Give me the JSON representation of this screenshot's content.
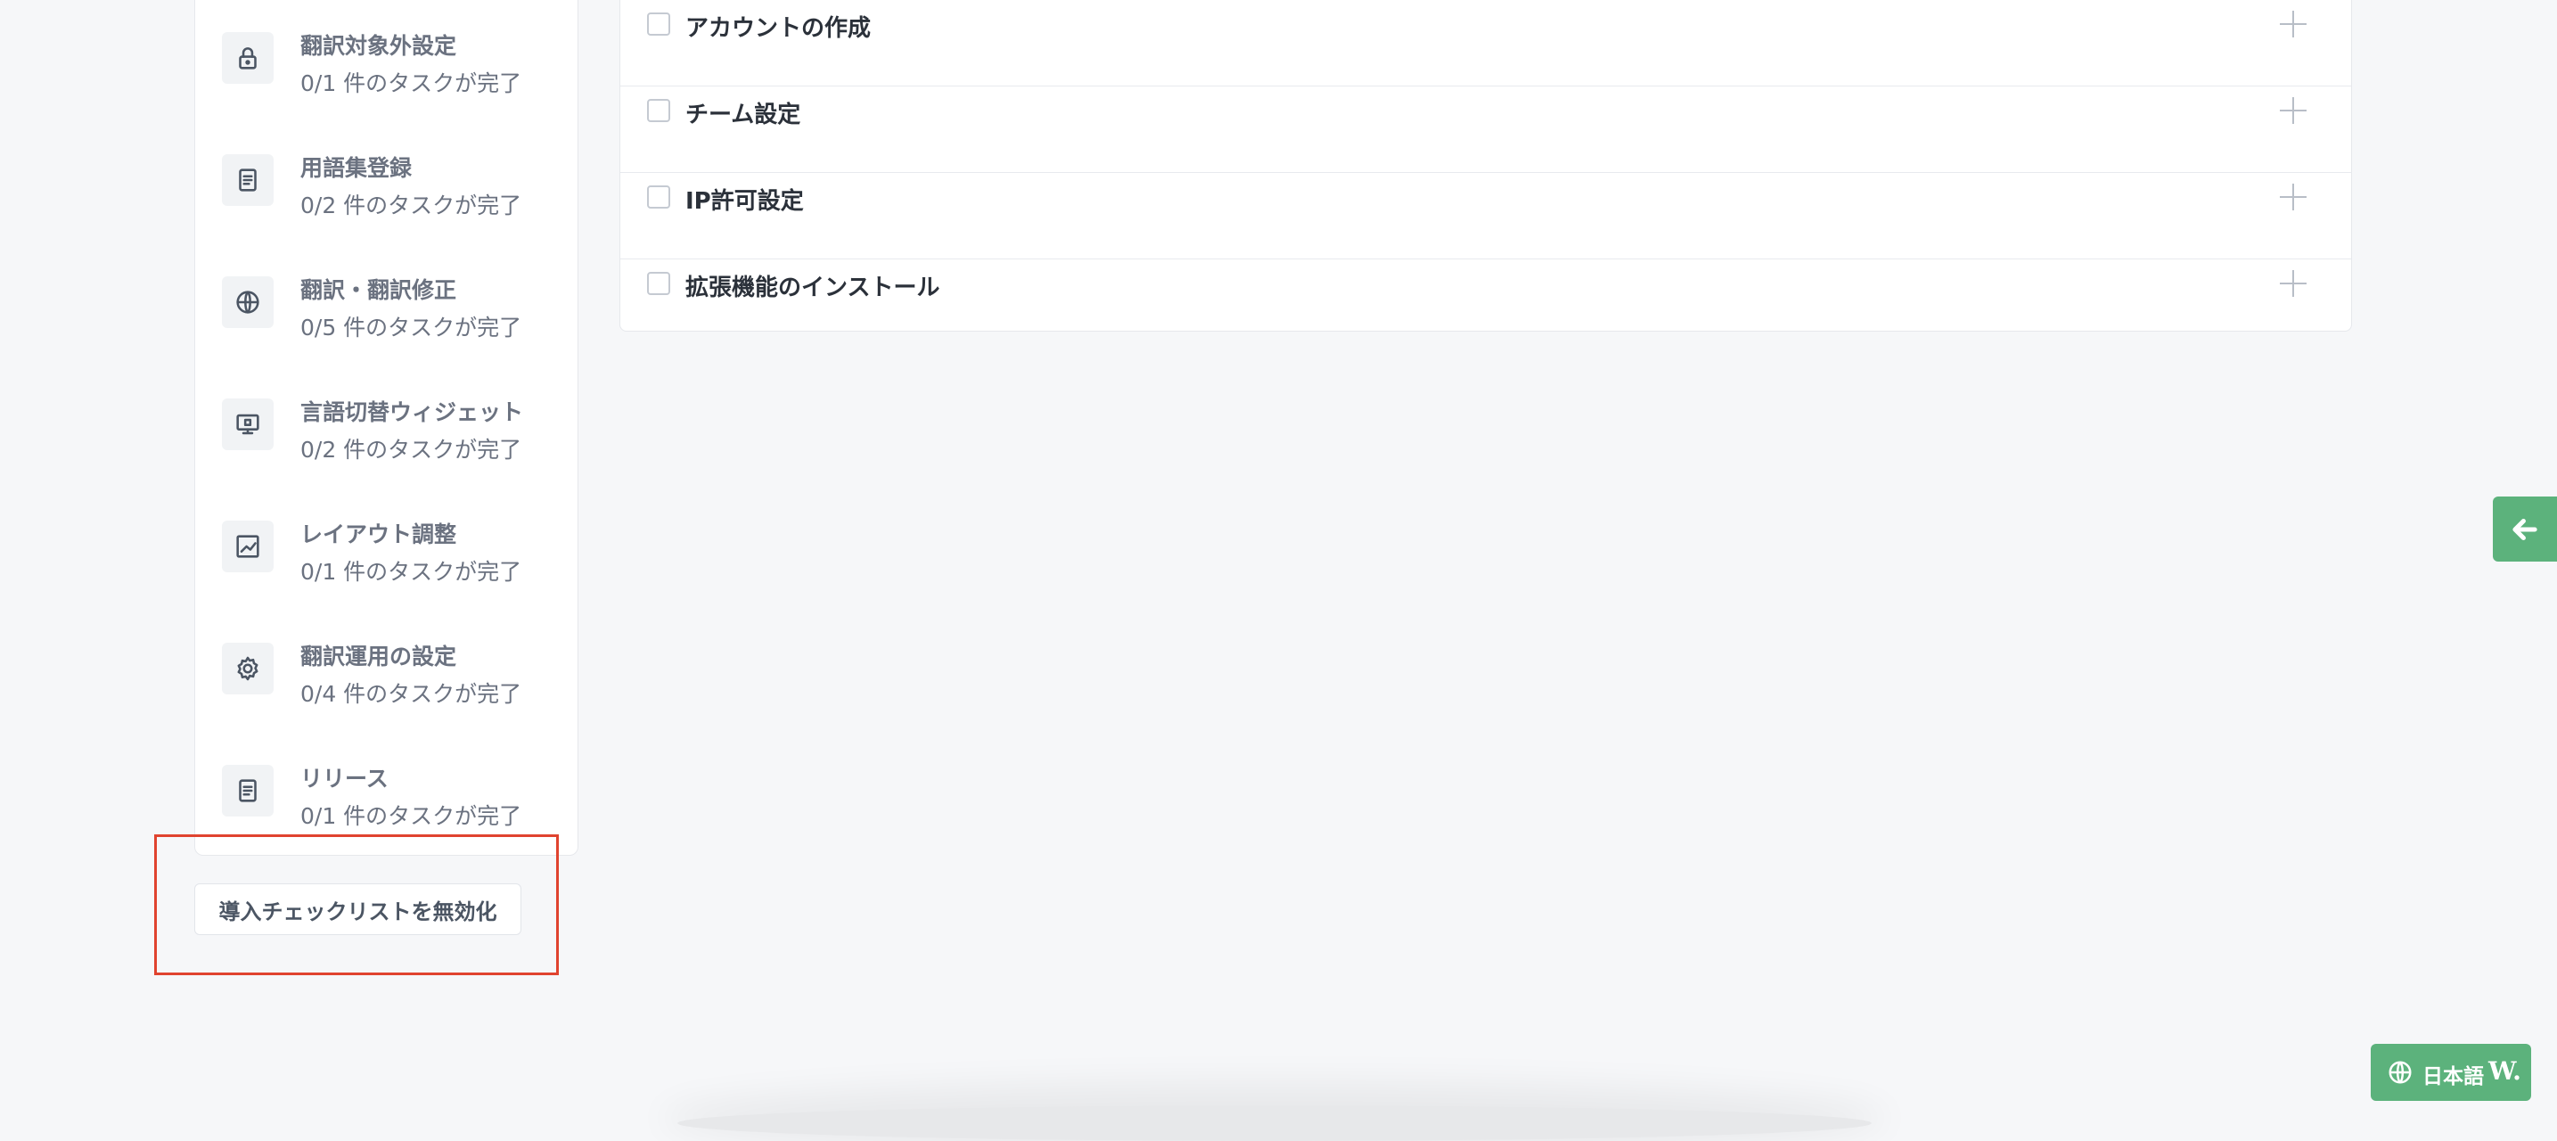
{
  "sidebar": {
    "steps": [
      {
        "title": "翻訳対象外設定",
        "progress": "0/1 件のタスクが完了",
        "icon": "lock-icon"
      },
      {
        "title": "用語集登録",
        "progress": "0/2 件のタスクが完了",
        "icon": "document-icon"
      },
      {
        "title": "翻訳・翻訳修正",
        "progress": "0/5 件のタスクが完了",
        "icon": "globe-icon"
      },
      {
        "title": "言語切替ウィジェット",
        "progress": "0/2 件のタスクが完了",
        "icon": "monitor-icon"
      },
      {
        "title": "レイアウト調整",
        "progress": "0/1 件のタスクが完了",
        "icon": "chart-icon"
      },
      {
        "title": "翻訳運用の設定",
        "progress": "0/4 件のタスクが完了",
        "icon": "gear-icon"
      },
      {
        "title": "リリース",
        "progress": "0/1 件のタスクが完了",
        "icon": "document-icon"
      }
    ],
    "disable_button_label": "導入チェックリストを無効化"
  },
  "tasks": [
    {
      "label": "アカウントの作成"
    },
    {
      "label": "チーム設定"
    },
    {
      "label": "IP許可設定"
    },
    {
      "label": "拡張機能のインストール"
    }
  ],
  "language_widget": {
    "label": "日本語",
    "brand": "W.",
    "color": "#5cb27c"
  },
  "highlight_color": "#e0432f"
}
